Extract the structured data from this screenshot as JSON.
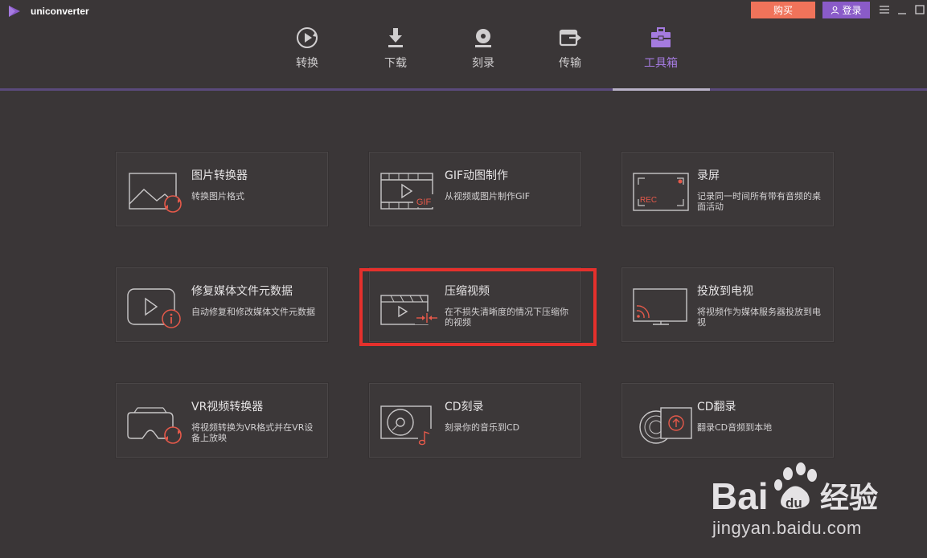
{
  "app": {
    "name": "uniconverter"
  },
  "titlebar": {
    "buy_label": "购买",
    "login_label": "登录"
  },
  "nav": {
    "items": [
      {
        "label": "转换",
        "icon": "convert-icon"
      },
      {
        "label": "下载",
        "icon": "download-icon"
      },
      {
        "label": "刻录",
        "icon": "burn-disc-icon"
      },
      {
        "label": "传输",
        "icon": "transfer-icon"
      },
      {
        "label": "工具箱",
        "icon": "toolbox-icon",
        "active": true
      }
    ]
  },
  "tools": [
    {
      "title": "图片转换器",
      "desc": "转换图片格式",
      "icon": "image-convert-icon"
    },
    {
      "title": "GIF动图制作",
      "desc": "从视频或图片制作GIF",
      "icon": "gif-maker-icon"
    },
    {
      "title": "录屏",
      "desc": "记录同一时间所有带有音频的桌面活动",
      "icon": "screen-record-icon"
    },
    {
      "title": "修复媒体文件元数据",
      "desc": "自动修复和修改媒体文件元数据",
      "icon": "metadata-fix-icon"
    },
    {
      "title": "压缩视频",
      "desc": "在不损失清晰度的情况下压缩你的视频",
      "icon": "compress-video-icon",
      "highlighted": true
    },
    {
      "title": "投放到电视",
      "desc": "将视频作为媒体服务器投放到电视",
      "icon": "cast-tv-icon"
    },
    {
      "title": "VR视频转换器",
      "desc": "将视频转换为VR格式并在VR设备上放映",
      "icon": "vr-convert-icon"
    },
    {
      "title": "CD刻录",
      "desc": "刻录你的音乐到CD",
      "icon": "cd-burn-icon"
    },
    {
      "title": "CD翻录",
      "desc": "翻录CD音频到本地",
      "icon": "cd-rip-icon"
    }
  ],
  "colors": {
    "accent": "#8a5bc8",
    "buy": "#f0735a",
    "icon_red": "#e5594a",
    "highlight": "#e5302c"
  },
  "watermark": {
    "text": "jingyan.baidu.com"
  }
}
